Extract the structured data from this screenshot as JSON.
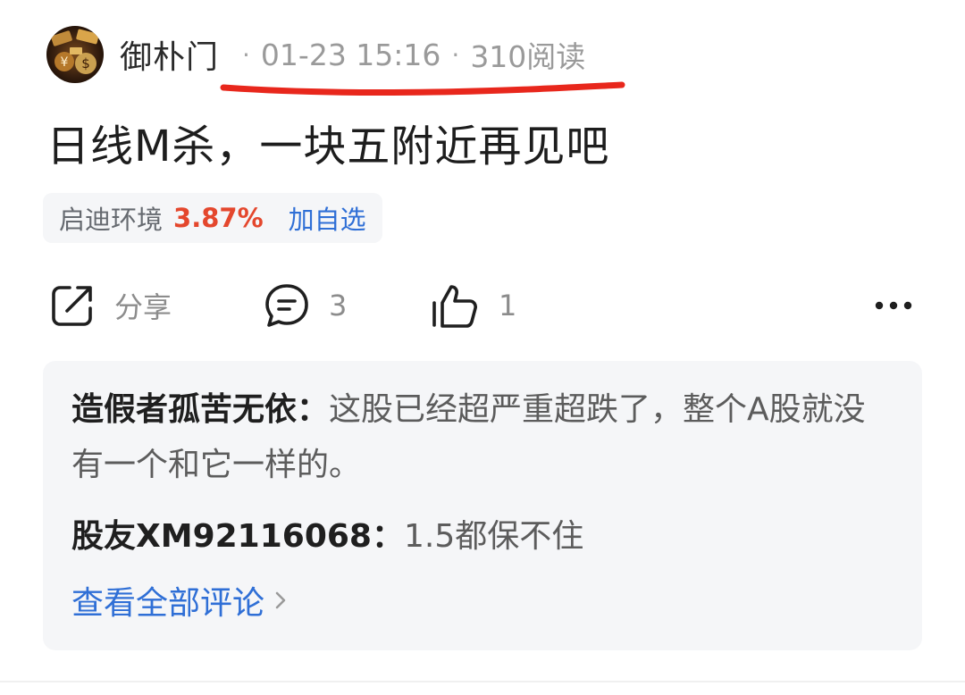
{
  "post": {
    "author": "御朴门",
    "date_time": "01-23 15:16",
    "reads": "310阅读",
    "separator": "·",
    "title": "日线M杀，一块五附近再见吧"
  },
  "stock": {
    "name": "启迪环境",
    "change": "3.87%",
    "add_watch_label": "加自选"
  },
  "actions": {
    "share_label": "分享",
    "comment_count": "3",
    "like_count": "1"
  },
  "comments": {
    "items": [
      {
        "user": "造假者孤苦无依",
        "separator": "：",
        "text": "这股已经超严重超跌了，整个A股就没有一个和它一样的。"
      },
      {
        "user": "股友XM92116068",
        "separator": "：",
        "text": "1.5都保不住"
      }
    ],
    "view_all_label": "查看全部评论"
  },
  "colors": {
    "stock_up": "#e4472d",
    "link_blue": "#2f6fd6",
    "annotation_red": "#e8271c",
    "card_background": "#f5f6f8"
  },
  "icons": {
    "share": "share-icon",
    "comment": "comment-bubble-icon",
    "like": "thumbs-up-icon",
    "more": "more-dots-icon",
    "view_all": "chevron-right-icon"
  }
}
